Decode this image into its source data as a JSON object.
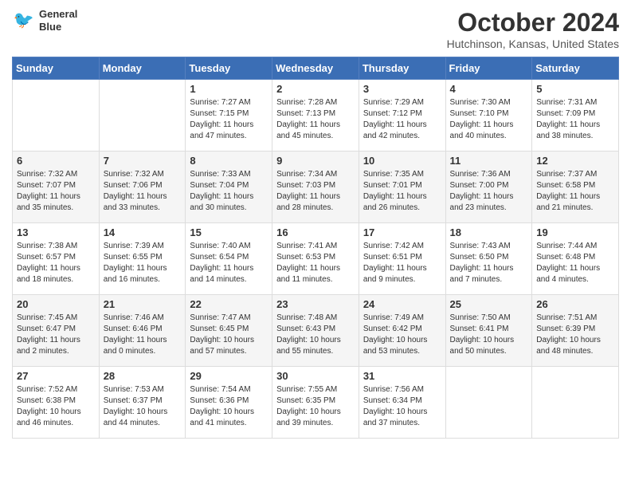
{
  "header": {
    "logo_line1": "General",
    "logo_line2": "Blue",
    "month": "October 2024",
    "location": "Hutchinson, Kansas, United States"
  },
  "weekdays": [
    "Sunday",
    "Monday",
    "Tuesday",
    "Wednesday",
    "Thursday",
    "Friday",
    "Saturday"
  ],
  "weeks": [
    [
      {
        "day": "",
        "info": ""
      },
      {
        "day": "",
        "info": ""
      },
      {
        "day": "1",
        "info": "Sunrise: 7:27 AM\nSunset: 7:15 PM\nDaylight: 11 hours and 47 minutes."
      },
      {
        "day": "2",
        "info": "Sunrise: 7:28 AM\nSunset: 7:13 PM\nDaylight: 11 hours and 45 minutes."
      },
      {
        "day": "3",
        "info": "Sunrise: 7:29 AM\nSunset: 7:12 PM\nDaylight: 11 hours and 42 minutes."
      },
      {
        "day": "4",
        "info": "Sunrise: 7:30 AM\nSunset: 7:10 PM\nDaylight: 11 hours and 40 minutes."
      },
      {
        "day": "5",
        "info": "Sunrise: 7:31 AM\nSunset: 7:09 PM\nDaylight: 11 hours and 38 minutes."
      }
    ],
    [
      {
        "day": "6",
        "info": "Sunrise: 7:32 AM\nSunset: 7:07 PM\nDaylight: 11 hours and 35 minutes."
      },
      {
        "day": "7",
        "info": "Sunrise: 7:32 AM\nSunset: 7:06 PM\nDaylight: 11 hours and 33 minutes."
      },
      {
        "day": "8",
        "info": "Sunrise: 7:33 AM\nSunset: 7:04 PM\nDaylight: 11 hours and 30 minutes."
      },
      {
        "day": "9",
        "info": "Sunrise: 7:34 AM\nSunset: 7:03 PM\nDaylight: 11 hours and 28 minutes."
      },
      {
        "day": "10",
        "info": "Sunrise: 7:35 AM\nSunset: 7:01 PM\nDaylight: 11 hours and 26 minutes."
      },
      {
        "day": "11",
        "info": "Sunrise: 7:36 AM\nSunset: 7:00 PM\nDaylight: 11 hours and 23 minutes."
      },
      {
        "day": "12",
        "info": "Sunrise: 7:37 AM\nSunset: 6:58 PM\nDaylight: 11 hours and 21 minutes."
      }
    ],
    [
      {
        "day": "13",
        "info": "Sunrise: 7:38 AM\nSunset: 6:57 PM\nDaylight: 11 hours and 18 minutes."
      },
      {
        "day": "14",
        "info": "Sunrise: 7:39 AM\nSunset: 6:55 PM\nDaylight: 11 hours and 16 minutes."
      },
      {
        "day": "15",
        "info": "Sunrise: 7:40 AM\nSunset: 6:54 PM\nDaylight: 11 hours and 14 minutes."
      },
      {
        "day": "16",
        "info": "Sunrise: 7:41 AM\nSunset: 6:53 PM\nDaylight: 11 hours and 11 minutes."
      },
      {
        "day": "17",
        "info": "Sunrise: 7:42 AM\nSunset: 6:51 PM\nDaylight: 11 hours and 9 minutes."
      },
      {
        "day": "18",
        "info": "Sunrise: 7:43 AM\nSunset: 6:50 PM\nDaylight: 11 hours and 7 minutes."
      },
      {
        "day": "19",
        "info": "Sunrise: 7:44 AM\nSunset: 6:48 PM\nDaylight: 11 hours and 4 minutes."
      }
    ],
    [
      {
        "day": "20",
        "info": "Sunrise: 7:45 AM\nSunset: 6:47 PM\nDaylight: 11 hours and 2 minutes."
      },
      {
        "day": "21",
        "info": "Sunrise: 7:46 AM\nSunset: 6:46 PM\nDaylight: 11 hours and 0 minutes."
      },
      {
        "day": "22",
        "info": "Sunrise: 7:47 AM\nSunset: 6:45 PM\nDaylight: 10 hours and 57 minutes."
      },
      {
        "day": "23",
        "info": "Sunrise: 7:48 AM\nSunset: 6:43 PM\nDaylight: 10 hours and 55 minutes."
      },
      {
        "day": "24",
        "info": "Sunrise: 7:49 AM\nSunset: 6:42 PM\nDaylight: 10 hours and 53 minutes."
      },
      {
        "day": "25",
        "info": "Sunrise: 7:50 AM\nSunset: 6:41 PM\nDaylight: 10 hours and 50 minutes."
      },
      {
        "day": "26",
        "info": "Sunrise: 7:51 AM\nSunset: 6:39 PM\nDaylight: 10 hours and 48 minutes."
      }
    ],
    [
      {
        "day": "27",
        "info": "Sunrise: 7:52 AM\nSunset: 6:38 PM\nDaylight: 10 hours and 46 minutes."
      },
      {
        "day": "28",
        "info": "Sunrise: 7:53 AM\nSunset: 6:37 PM\nDaylight: 10 hours and 44 minutes."
      },
      {
        "day": "29",
        "info": "Sunrise: 7:54 AM\nSunset: 6:36 PM\nDaylight: 10 hours and 41 minutes."
      },
      {
        "day": "30",
        "info": "Sunrise: 7:55 AM\nSunset: 6:35 PM\nDaylight: 10 hours and 39 minutes."
      },
      {
        "day": "31",
        "info": "Sunrise: 7:56 AM\nSunset: 6:34 PM\nDaylight: 10 hours and 37 minutes."
      },
      {
        "day": "",
        "info": ""
      },
      {
        "day": "",
        "info": ""
      }
    ]
  ]
}
